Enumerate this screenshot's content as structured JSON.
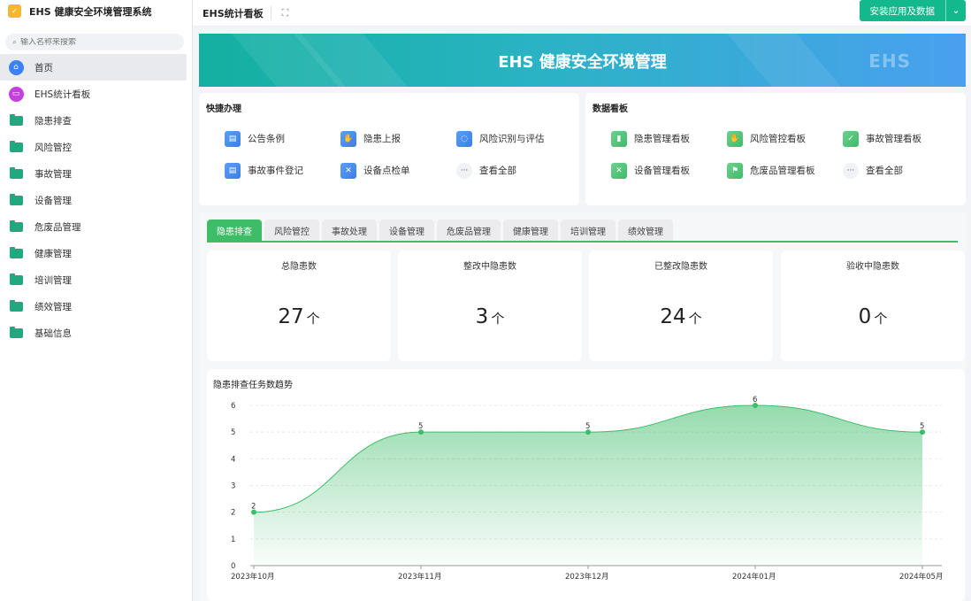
{
  "app": {
    "title": "EHS 健康安全环境管理系统"
  },
  "search": {
    "placeholder": "输入名称来搜索"
  },
  "sidebar": {
    "items": [
      {
        "label": "首页",
        "icon": "home-icon"
      },
      {
        "label": "EHS统计看板",
        "icon": "monitor-icon"
      },
      {
        "label": "隐患排查",
        "icon": "folder-icon"
      },
      {
        "label": "风险管控",
        "icon": "folder-icon"
      },
      {
        "label": "事故管理",
        "icon": "folder-icon"
      },
      {
        "label": "设备管理",
        "icon": "folder-icon"
      },
      {
        "label": "危废品管理",
        "icon": "folder-icon"
      },
      {
        "label": "健康管理",
        "icon": "folder-icon"
      },
      {
        "label": "培训管理",
        "icon": "folder-icon"
      },
      {
        "label": "绩效管理",
        "icon": "folder-icon"
      },
      {
        "label": "基础信息",
        "icon": "folder-icon"
      }
    ]
  },
  "topbar": {
    "title": "EHS统计看板",
    "install_label": "安装应用及数据"
  },
  "banner": {
    "title": "EHS 健康安全环境管理",
    "watermark": "EHS"
  },
  "quick": {
    "title": "快捷办理",
    "items": [
      {
        "label": "公告条例",
        "icon": "clipboard-icon"
      },
      {
        "label": "隐患上报",
        "icon": "hand-icon"
      },
      {
        "label": "风险识别与评估",
        "icon": "cycle-icon"
      },
      {
        "label": "事故事件登记",
        "icon": "clipboard-icon"
      },
      {
        "label": "设备点检单",
        "icon": "tools-icon"
      },
      {
        "label": "查看全部",
        "icon": "more-icon"
      }
    ]
  },
  "dashboards": {
    "title": "数据看板",
    "items": [
      {
        "label": "隐患管理看板",
        "icon": "bar-chart-icon"
      },
      {
        "label": "风险管控看板",
        "icon": "hand-icon"
      },
      {
        "label": "事故管理看板",
        "icon": "clipboard-check-icon"
      },
      {
        "label": "设备管理看板",
        "icon": "tools-icon"
      },
      {
        "label": "危废品管理看板",
        "icon": "flag-icon"
      },
      {
        "label": "查看全部",
        "icon": "more-icon"
      }
    ]
  },
  "tabs": [
    "隐患排查",
    "风险管控",
    "事故处理",
    "设备管理",
    "危废品管理",
    "健康管理",
    "培训管理",
    "绩效管理"
  ],
  "stats": [
    {
      "label": "总隐患数",
      "value": "27",
      "unit": "个"
    },
    {
      "label": "整改中隐患数",
      "value": "3",
      "unit": "个"
    },
    {
      "label": "已整改隐患数",
      "value": "24",
      "unit": "个"
    },
    {
      "label": "验收中隐患数",
      "value": "0",
      "unit": "个"
    }
  ],
  "chart_data": {
    "type": "area",
    "title": "隐患排查任务数趋势",
    "categories": [
      "2023年10月",
      "2023年11月",
      "2023年12月",
      "2024年01月",
      "2024年05月"
    ],
    "values": [
      2,
      5,
      5,
      6,
      5
    ],
    "ylim": [
      0,
      6
    ],
    "yticks": [
      "0",
      "1",
      "2",
      "3",
      "4",
      "5",
      "6"
    ],
    "color": "#3ebd69"
  }
}
